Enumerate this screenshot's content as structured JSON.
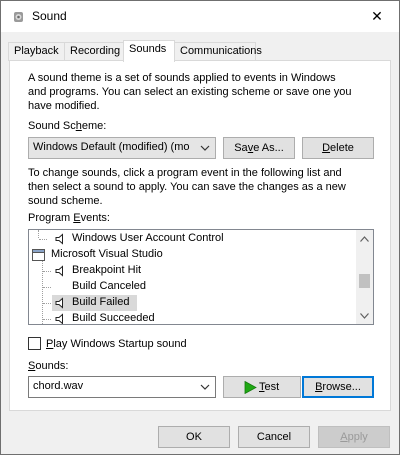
{
  "window": {
    "title": "Sound",
    "close_glyph": "✕"
  },
  "tabs": [
    {
      "label": "Playback"
    },
    {
      "label": "Recording"
    },
    {
      "label": "Sounds"
    },
    {
      "label": "Communications"
    }
  ],
  "intro_lines": [
    "A sound theme is a set of sounds applied to events in Windows",
    "and programs.  You can select an existing scheme or save one you",
    "have modified."
  ],
  "scheme": {
    "label_pre": "Sound Sc",
    "label_u": "h",
    "label_post": "eme:",
    "value": "Windows Default (modified) (mo",
    "save_as_pre": "Sa",
    "save_as_u": "v",
    "save_as_post": "e As...",
    "delete_u": "D",
    "delete_post": "elete"
  },
  "change_lines": [
    "To change sounds, click a program event in the following list and",
    "then select a sound to apply.  You can save the changes as a new",
    "sound scheme."
  ],
  "events": {
    "label_pre": "Program ",
    "label_u": "E",
    "label_post": "vents:",
    "items": [
      {
        "label": "Windows User Account Control"
      },
      {
        "label": "Microsoft Visual Studio"
      },
      {
        "label": "Breakpoint Hit"
      },
      {
        "label": "Build Canceled"
      },
      {
        "label": "Build Failed"
      },
      {
        "label": "Build Succeeded"
      }
    ]
  },
  "startup": {
    "pre": "",
    "u": "P",
    "post": "lay Windows Startup sound",
    "checked": false
  },
  "sounds": {
    "label_pre": "",
    "label_u": "S",
    "label_post": "ounds:",
    "value": "chord.wav",
    "test_u": "T",
    "test_post": "est",
    "browse_u": "B",
    "browse_post": "rowse..."
  },
  "footer": {
    "ok": "OK",
    "cancel": "Cancel",
    "apply_u": "A",
    "apply_post": "pply"
  },
  "colors": {
    "accent": "#0078d7",
    "test_play": "#1fa814"
  }
}
